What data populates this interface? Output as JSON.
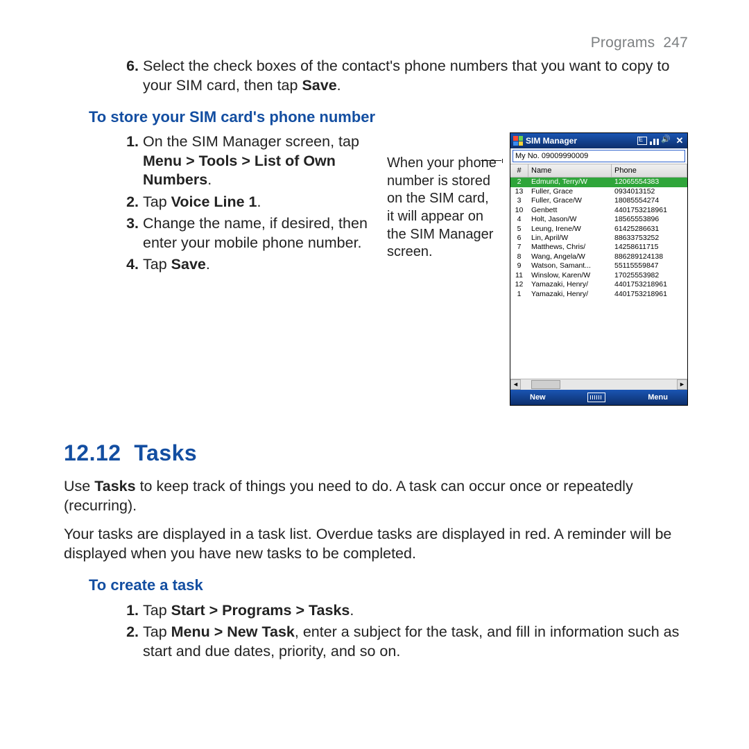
{
  "header": {
    "section": "Programs",
    "page": "247"
  },
  "step6": {
    "num": "6.",
    "text_a": "Select the check boxes of the contact's phone numbers that you want to copy to your SIM card, then tap ",
    "bold": "Save",
    "text_b": "."
  },
  "h_store": "To store your SIM card's phone number",
  "steps_store": [
    {
      "num": "1.",
      "t1": "On the SIM Manager screen, tap ",
      "b": "Menu > Tools > List of Own Numbers",
      "t2": "."
    },
    {
      "num": "2.",
      "t1": "Tap ",
      "b": "Voice Line 1",
      "t2": "."
    },
    {
      "num": "3.",
      "t1": "Change the name, if desired, then enter your mobile phone number.",
      "b": "",
      "t2": ""
    },
    {
      "num": "4.",
      "t1": "Tap ",
      "b": "Save",
      "t2": "."
    }
  ],
  "caption": "When your phone number is stored on the SIM card, it will appear on the SIM Manager screen.",
  "phone": {
    "title": "SIM Manager",
    "myno": "My No. 09009990009",
    "hdr": {
      "idx": "#",
      "name": "Name",
      "phone": "Phone"
    },
    "rows": [
      {
        "i": "2",
        "n": "Edmund, Terry/W",
        "p": "12065554383",
        "sel": true
      },
      {
        "i": "13",
        "n": "Fuller, Grace",
        "p": "0934013152"
      },
      {
        "i": "3",
        "n": "Fuller, Grace/W",
        "p": "18085554274"
      },
      {
        "i": "10",
        "n": "Genbett",
        "p": "4401753218961"
      },
      {
        "i": "4",
        "n": "Holt, Jason/W",
        "p": "18565553896"
      },
      {
        "i": "5",
        "n": "Leung, Irene/W",
        "p": "61425286631"
      },
      {
        "i": "6",
        "n": "Lin, April/W",
        "p": "88633753252"
      },
      {
        "i": "7",
        "n": "Matthews, Chris/",
        "p": "14258611715"
      },
      {
        "i": "8",
        "n": "Wang, Angela/W",
        "p": "886289124138"
      },
      {
        "i": "9",
        "n": "Watson, Samant...",
        "p": "55115559847"
      },
      {
        "i": "11",
        "n": "Winslow, Karen/W",
        "p": "17025553982"
      },
      {
        "i": "12",
        "n": "Yamazaki, Henry/",
        "p": "4401753218961"
      },
      {
        "i": "1",
        "n": "Yamazaki, Henry/",
        "p": "4401753218961"
      }
    ],
    "soft": {
      "left": "New",
      "right": "Menu"
    },
    "scroll": {
      "left": "◄",
      "right": "►"
    }
  },
  "sect": {
    "num": "12.12",
    "title": "Tasks"
  },
  "tasks_p1a": "Use ",
  "tasks_p1b": "Tasks",
  "tasks_p1c": " to keep track of things you need to do. A task can occur once or repeatedly (recurring).",
  "tasks_p2": "Your tasks are displayed in a task list. Overdue tasks are displayed in red. A reminder will be displayed when you have new tasks to be completed.",
  "h_create": "To create a task",
  "steps_create": [
    {
      "num": "1.",
      "t1": "Tap ",
      "b": "Start > Programs > Tasks",
      "t2": "."
    },
    {
      "num": "2.",
      "t1": "Tap ",
      "b": "Menu > New Task",
      "t2": ", enter a subject for the task, and fill in information such as start and due dates, priority, and so on."
    }
  ]
}
